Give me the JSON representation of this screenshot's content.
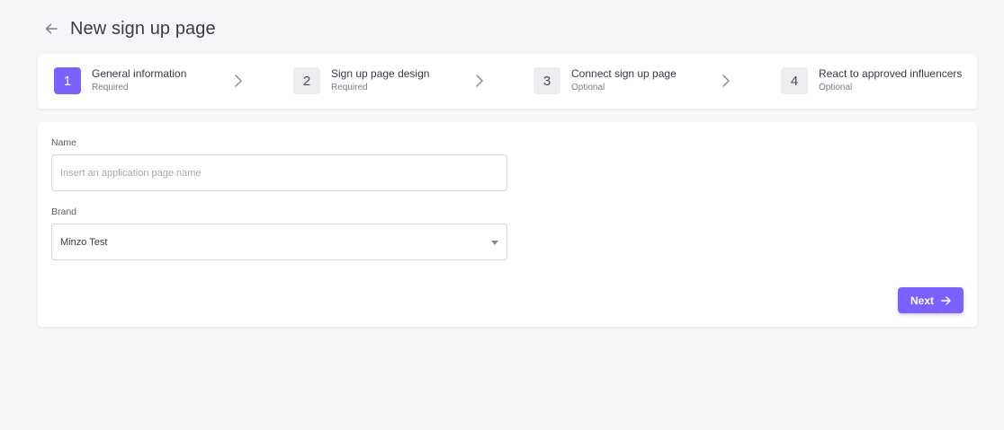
{
  "header": {
    "title": "New sign up page",
    "back_icon": "arrow-left-icon"
  },
  "stepper": {
    "steps": [
      {
        "number": "1",
        "title": "General information",
        "subtitle": "Required",
        "active": true
      },
      {
        "number": "2",
        "title": "Sign up page design",
        "subtitle": "Required",
        "active": false
      },
      {
        "number": "3",
        "title": "Connect sign up page",
        "subtitle": "Optional",
        "active": false
      },
      {
        "number": "4",
        "title": "React to approved influencers",
        "subtitle": "Optional",
        "active": false
      }
    ]
  },
  "form": {
    "name_label": "Name",
    "name_value": "",
    "name_placeholder": "Insert an application page name",
    "brand_label": "Brand",
    "brand_value": "Minzo Test",
    "next_label": "Next"
  },
  "colors": {
    "accent": "#7b61ff",
    "background": "#f7f7fa",
    "card": "#ffffff"
  }
}
